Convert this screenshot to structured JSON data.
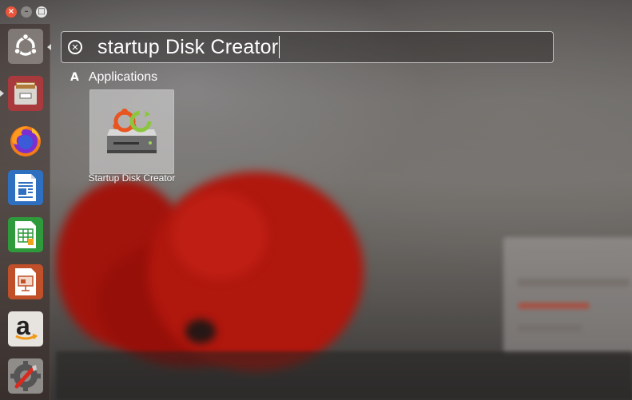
{
  "window": {
    "close_label": "×",
    "minimize_label": "–",
    "maximize_label": "□"
  },
  "launcher": {
    "items": [
      {
        "name": "Ubuntu Dash",
        "icon": "ubuntu-logo-icon"
      },
      {
        "name": "Files",
        "icon": "file-cabinet-icon"
      },
      {
        "name": "Firefox Web Browser",
        "icon": "firefox-icon"
      },
      {
        "name": "LibreOffice Writer",
        "icon": "writer-icon"
      },
      {
        "name": "LibreOffice Calc",
        "icon": "calc-icon"
      },
      {
        "name": "LibreOffice Impress",
        "icon": "impress-icon"
      },
      {
        "name": "Amazon",
        "icon": "amazon-icon",
        "glyph": "a"
      },
      {
        "name": "System Settings",
        "icon": "settings-icon"
      }
    ]
  },
  "search": {
    "query": "startup Disk Creator"
  },
  "category": {
    "label": "Applications",
    "icon_glyph": "A"
  },
  "result": {
    "label": "Startup Disk Creator",
    "icon": "startup-disk-creator-icon"
  }
}
